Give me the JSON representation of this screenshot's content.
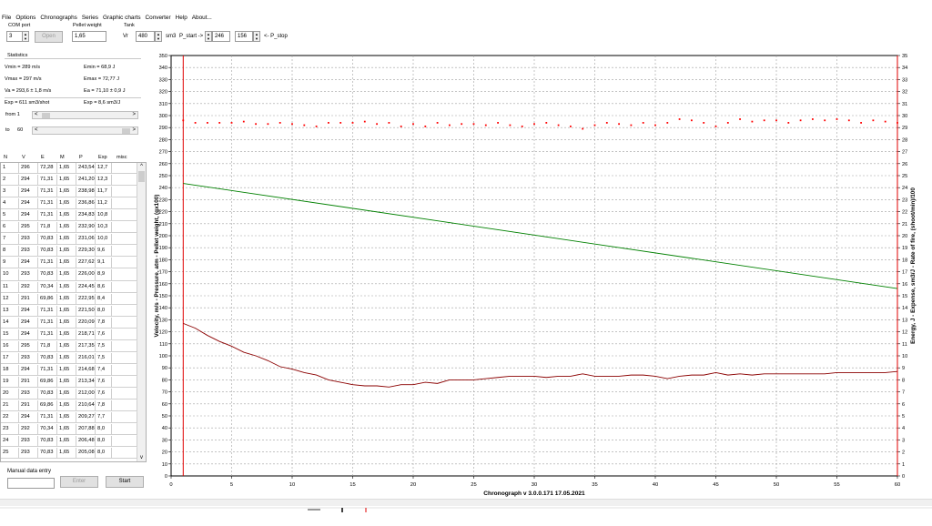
{
  "menu": [
    "File",
    "Options",
    "Chronographs",
    "Series",
    "Graphic charts",
    "Converter",
    "Help",
    "About..."
  ],
  "toolbar": {
    "com_label": "COM port",
    "com_value": "3",
    "open_label": "Open",
    "pellet_label": "Pellet weight",
    "pellet_value": "1,65",
    "tank_label": "Tank",
    "vr_label": "Vr",
    "vr_value": "480",
    "vr_unit": "sm3",
    "pstart_label": "P_start ->",
    "pstart_value": "246",
    "pstop_value": "156",
    "pstop_label": "<- P_stop"
  },
  "stats": {
    "title": "Statistics",
    "vmin": "Vmin = 289 m/s",
    "vmax": "Vmax = 297 m/s",
    "va": "Va = 293,6 ± 1,8 m/s",
    "emin": "Emin = 68,9 J",
    "emax": "Emax = 72,77 J",
    "ea": "Ea = 71,10 ± 0,9 J",
    "exp_shot": "Exp = 611 sm3/shot",
    "exp_j": "Exp = 8,6 sm3/J",
    "from_label": "from 1",
    "to_label": "to",
    "to_value": "60"
  },
  "table": {
    "headers": [
      "N",
      "V",
      "E",
      "M",
      "P",
      "Exp",
      "misc"
    ],
    "rows": [
      [
        "1",
        "296",
        "72,28",
        "1,65",
        "243,54",
        "12,7"
      ],
      [
        "2",
        "294",
        "71,31",
        "1,65",
        "241,20",
        "12,3"
      ],
      [
        "3",
        "294",
        "71,31",
        "1,65",
        "238,98",
        "11,7"
      ],
      [
        "4",
        "294",
        "71,31",
        "1,65",
        "236,86",
        "11,2"
      ],
      [
        "5",
        "294",
        "71,31",
        "1,65",
        "234,83",
        "10,8"
      ],
      [
        "6",
        "295",
        "71,8",
        "1,65",
        "232,90",
        "10,3"
      ],
      [
        "7",
        "293",
        "70,83",
        "1,65",
        "231,06",
        "10,0"
      ],
      [
        "8",
        "293",
        "70,83",
        "1,65",
        "229,30",
        "9,6"
      ],
      [
        "9",
        "294",
        "71,31",
        "1,65",
        "227,62",
        "9,1"
      ],
      [
        "10",
        "293",
        "70,83",
        "1,65",
        "226,00",
        "8,9"
      ],
      [
        "11",
        "292",
        "70,34",
        "1,65",
        "224,45",
        "8,6"
      ],
      [
        "12",
        "291",
        "69,86",
        "1,65",
        "222,95",
        "8,4"
      ],
      [
        "13",
        "294",
        "71,31",
        "1,65",
        "221,50",
        "8,0"
      ],
      [
        "14",
        "294",
        "71,31",
        "1,65",
        "220,09",
        "7,8"
      ],
      [
        "15",
        "294",
        "71,31",
        "1,65",
        "218,71",
        "7,6"
      ],
      [
        "16",
        "295",
        "71,8",
        "1,65",
        "217,35",
        "7,5"
      ],
      [
        "17",
        "293",
        "70,83",
        "1,65",
        "216,01",
        "7,5"
      ],
      [
        "18",
        "294",
        "71,31",
        "1,65",
        "214,68",
        "7,4"
      ],
      [
        "19",
        "291",
        "69,86",
        "1,65",
        "213,34",
        "7,6"
      ],
      [
        "20",
        "293",
        "70,83",
        "1,65",
        "212,00",
        "7,6"
      ],
      [
        "21",
        "291",
        "69,86",
        "1,65",
        "210,64",
        "7,8"
      ],
      [
        "22",
        "294",
        "71,31",
        "1,65",
        "209,27",
        "7,7"
      ],
      [
        "23",
        "292",
        "70,34",
        "1,65",
        "207,88",
        "8,0"
      ],
      [
        "24",
        "293",
        "70,83",
        "1,65",
        "206,48",
        "8,0"
      ],
      [
        "25",
        "293",
        "70,83",
        "1,65",
        "205,08",
        "8,0"
      ]
    ]
  },
  "manual": {
    "title": "Manual data entry",
    "enter_label": "Enter",
    "start_label": "Start"
  },
  "chart_data": {
    "type": "line",
    "title": "",
    "footer": "Chronograph v 3.0.0.171      17.05.2021",
    "ylabel_left": "Velocity, m/s - Pressure, atm - Pellet weight, (gx100)",
    "ylabel_right": "Energy, J - Expense, sm3/J - Rate of fire, (shoot/min)/100",
    "xlim": [
      0,
      60
    ],
    "xticks": [
      0,
      5,
      10,
      15,
      20,
      25,
      30,
      35,
      40,
      45,
      50,
      55,
      60
    ],
    "ylim_left": [
      0,
      350
    ],
    "yticks_left_step": 10,
    "ylim_right": [
      0,
      35
    ],
    "yticks_right_step": 1,
    "grid": true,
    "vertical_markers": [
      1,
      60
    ],
    "series": [
      {
        "color": "#ff0000",
        "style": "points",
        "x": [
          1,
          2,
          3,
          4,
          5,
          6,
          7,
          8,
          9,
          10,
          11,
          12,
          13,
          14,
          15,
          16,
          17,
          18,
          19,
          20,
          21,
          22,
          23,
          24,
          25,
          26,
          27,
          28,
          29,
          30,
          31,
          32,
          33,
          34,
          35,
          36,
          37,
          38,
          39,
          40,
          41,
          42,
          43,
          44,
          45,
          46,
          47,
          48,
          49,
          50,
          51,
          52,
          53,
          54,
          55,
          56,
          57,
          58,
          59,
          60
        ],
        "values": [
          296,
          294,
          294,
          294,
          294,
          295,
          293,
          293,
          294,
          293,
          292,
          291,
          294,
          294,
          294,
          295,
          293,
          294,
          291,
          293,
          291,
          294,
          292,
          293,
          293,
          292,
          294,
          292,
          291,
          293,
          294,
          292,
          291,
          289,
          292,
          294,
          293,
          292,
          294,
          292,
          294,
          297,
          296,
          294,
          291,
          294,
          297,
          295,
          296,
          296,
          294,
          296,
          297,
          296,
          297,
          296,
          294,
          296,
          295,
          294
        ]
      },
      {
        "color": "#008000",
        "style": "line",
        "x": [
          1,
          60
        ],
        "values": [
          243.54,
          156
        ]
      },
      {
        "color": "#8b0000",
        "style": "line",
        "x": [
          1,
          2,
          3,
          4,
          5,
          6,
          7,
          8,
          9,
          10,
          11,
          12,
          13,
          14,
          15,
          16,
          17,
          18,
          19,
          20,
          21,
          22,
          23,
          24,
          25,
          26,
          27,
          28,
          29,
          30,
          31,
          32,
          33,
          34,
          35,
          36,
          37,
          38,
          39,
          40,
          41,
          42,
          43,
          44,
          45,
          46,
          47,
          48,
          49,
          50,
          51,
          52,
          53,
          54,
          55,
          56,
          57,
          58,
          59,
          60
        ],
        "values": [
          12.7,
          12.3,
          11.7,
          11.2,
          10.8,
          10.3,
          10.0,
          9.6,
          9.1,
          8.9,
          8.6,
          8.4,
          8.0,
          7.8,
          7.6,
          7.5,
          7.5,
          7.4,
          7.6,
          7.6,
          7.8,
          7.7,
          8.0,
          8.0,
          8.0,
          8.1,
          8.2,
          8.3,
          8.3,
          8.3,
          8.2,
          8.3,
          8.3,
          8.5,
          8.3,
          8.3,
          8.3,
          8.4,
          8.4,
          8.3,
          8.1,
          8.3,
          8.4,
          8.4,
          8.6,
          8.4,
          8.5,
          8.4,
          8.5,
          8.5,
          8.5,
          8.5,
          8.5,
          8.5,
          8.6,
          8.6,
          8.6,
          8.6,
          8.6,
          8.7
        ]
      }
    ]
  }
}
